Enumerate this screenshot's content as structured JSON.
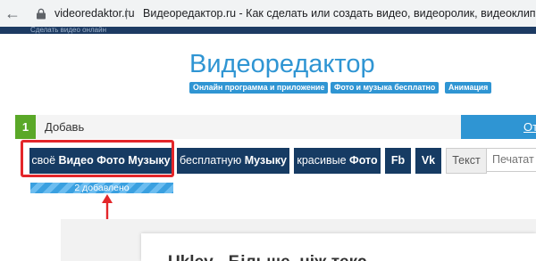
{
  "browser": {
    "domain": "videoredaktor.ru",
    "separator": "|",
    "title": "Видеоредактор.ru - Как сделать или создать видео, видеоролик, видеоклип, клип, анимацию, слайд шоу"
  },
  "site": {
    "topbar_text": "Сделать видео онлайн",
    "logo": "Видеоредактор",
    "badges": [
      "Онлайн программа и приложение",
      "Фото и музыка бесплатно",
      "Анимация"
    ]
  },
  "step": {
    "number": "1",
    "label": "Добавь",
    "right_link": "От"
  },
  "buttons": [
    {
      "pre": "своё ",
      "bold": "Видео Фото Музыку"
    },
    {
      "pre": "бесплатную ",
      "bold": "Музыку"
    },
    {
      "pre": "красивые ",
      "bold": "Фото"
    },
    {
      "pre": "",
      "bold": "Fb"
    },
    {
      "pre": "",
      "bold": "Vk"
    }
  ],
  "text_field": {
    "label": "Текст",
    "placeholder": "Печатать"
  },
  "progress": {
    "label": "2 добавлено",
    "fraction": 1.0
  },
  "card": {
    "heading": "Ukley - Більше, ніж текс"
  },
  "colors": {
    "accent": "#2f95d3",
    "button": "#163b63",
    "step_green": "#5aa828",
    "highlight_red": "#e3262a"
  }
}
